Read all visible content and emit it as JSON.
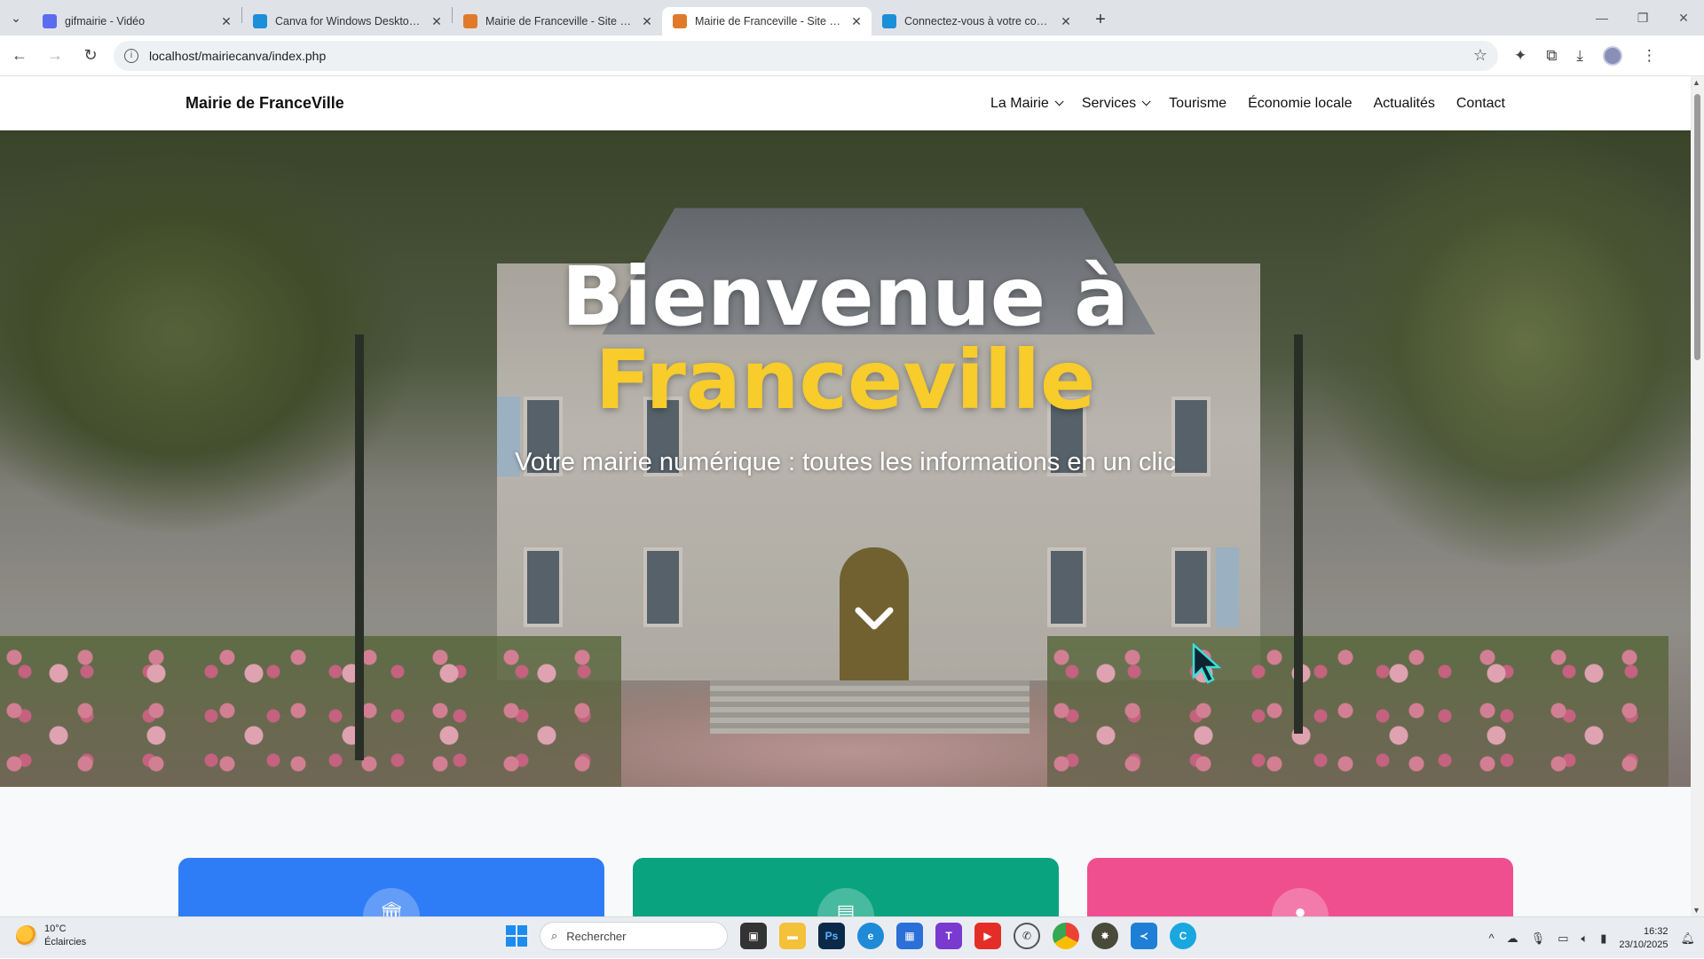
{
  "browser": {
    "tabs": [
      {
        "title": "gifmairie - Vidéo",
        "active": false,
        "favicon": "video-icon",
        "color": "#5b6cf0"
      },
      {
        "title": "Canva for Windows Desktop App",
        "active": false,
        "favicon": "canva-icon",
        "color": "#1b8fd8"
      },
      {
        "title": "Mairie de Franceville - Site Officiel",
        "active": false,
        "favicon": "site-icon",
        "color": "#e07a2a"
      },
      {
        "title": "Mairie de Franceville - Site Officiel",
        "active": true,
        "favicon": "site-icon",
        "color": "#e07a2a"
      },
      {
        "title": "Connectez-vous à votre compte",
        "active": false,
        "favicon": "canva-icon",
        "color": "#1b8fd8"
      }
    ],
    "url": "localhost/mairiecanva/index.php"
  },
  "site": {
    "brand": "Mairie de FranceVille",
    "menu": [
      {
        "label": "La Mairie",
        "dropdown": true
      },
      {
        "label": "Services",
        "dropdown": true
      },
      {
        "label": "Tourisme",
        "dropdown": false
      },
      {
        "label": "Économie locale",
        "dropdown": false
      },
      {
        "label": "Actualités",
        "dropdown": false
      },
      {
        "label": "Contact",
        "dropdown": false
      }
    ],
    "hero": {
      "title_line1": "Bienvenue à",
      "title_line2": "Franceville",
      "subtitle": "Votre mairie numérique : toutes les informations en un clic",
      "title_color": "#ffffff",
      "accent_color": "#f7cc2b"
    },
    "cards": [
      {
        "color": "#2f7df6",
        "icon": "town-hall-icon"
      },
      {
        "color": "#0aa37f",
        "icon": "document-icon"
      },
      {
        "color": "#ef4f8f",
        "icon": "person-icon"
      }
    ]
  },
  "taskbar": {
    "weather": {
      "temp": "10°C",
      "condition": "Éclaircies"
    },
    "search_placeholder": "Rechercher",
    "time": "16:32",
    "date": "23/10/2025"
  }
}
